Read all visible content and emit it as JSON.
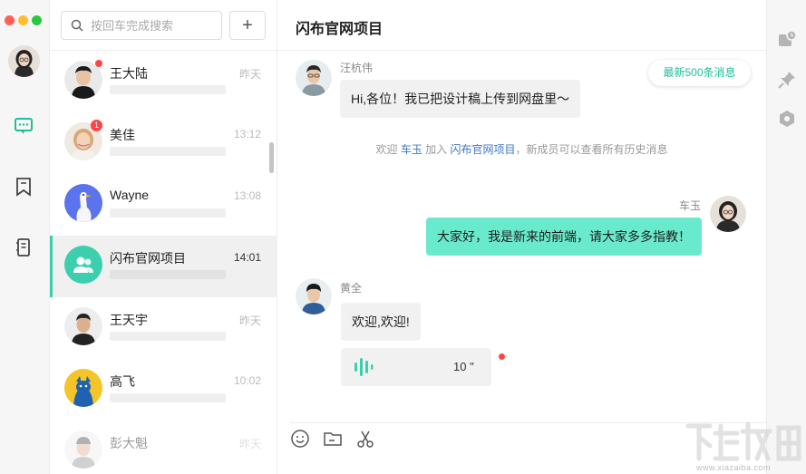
{
  "window": {
    "title": "闪布官网项目"
  },
  "search": {
    "placeholder": "按回车完成搜索"
  },
  "add_button": {
    "label": "+"
  },
  "contacts": [
    {
      "name": "王大陆",
      "time": "昨天"
    },
    {
      "name": "美佳",
      "time": "13:12",
      "badge": "1"
    },
    {
      "name": "Wayne",
      "time": "13:08"
    },
    {
      "name": "闪布官网项目",
      "time": "14:01"
    },
    {
      "name": "王天宇",
      "time": "昨天"
    },
    {
      "name": "高飞",
      "time": "10:02"
    },
    {
      "name": "彭大魁",
      "time": "昨天"
    }
  ],
  "chat": {
    "title": "闪布官网项目",
    "latest_button": "最新500条消息",
    "messages": [
      {
        "sender": "汪杭伟",
        "text": "Hi,各位！我已把设计稿上传到网盘里～"
      },
      {
        "sender": "车玉",
        "text": "大家好，我是新来的前端，请大家多多指教！"
      },
      {
        "sender": "黄全",
        "text": "欢迎,欢迎!"
      }
    ],
    "system": {
      "prefix": "欢迎 ",
      "user": "车玉",
      "mid": " 加入 ",
      "group": "闪布官网项目",
      "suffix": "，新成员可以查看所有历史消息"
    },
    "voice": {
      "length": "10 \""
    }
  },
  "watermark": {
    "site": "www.xiazaiba.com"
  },
  "colors": {
    "accent": "#3ccfae",
    "bubble_out": "#6aeacc",
    "link": "#3e77c6",
    "unread": "#ff4444"
  }
}
